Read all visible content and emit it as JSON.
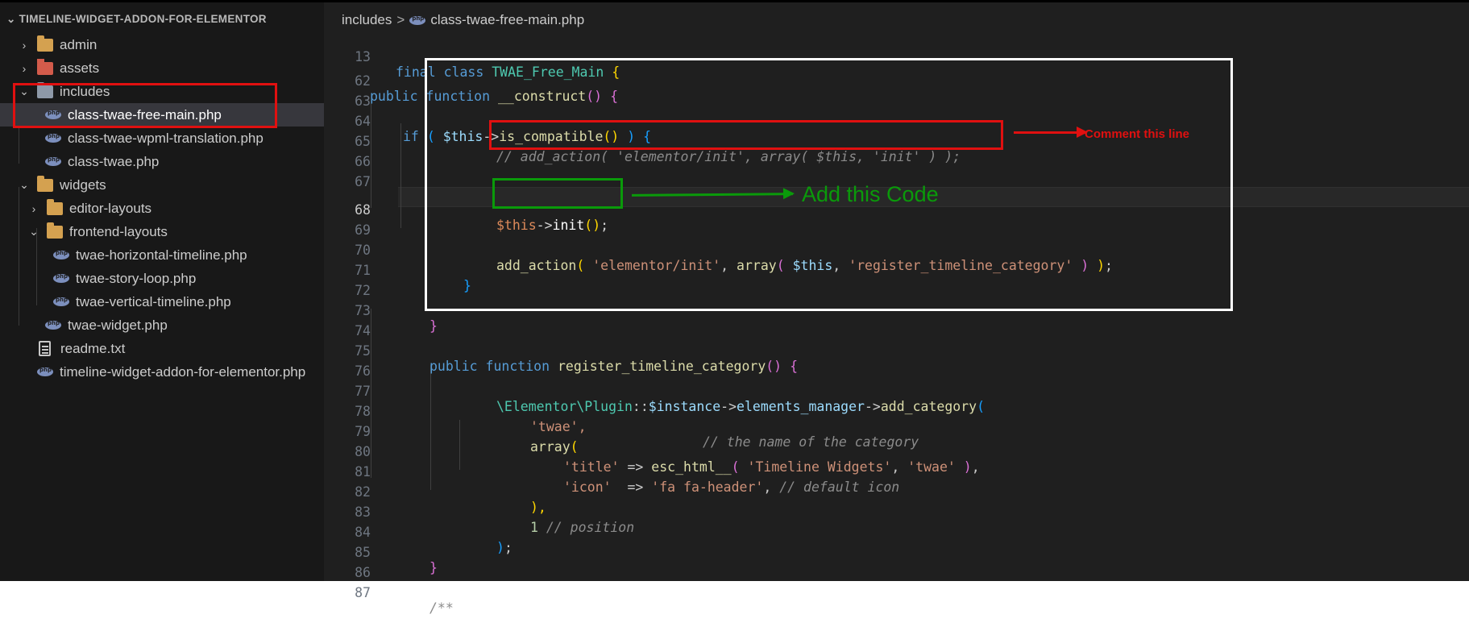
{
  "explorer": {
    "header": "TIMELINE-WIDGET-ADDON-FOR-ELEMENTOR",
    "items": [
      {
        "label": "admin",
        "type": "folder",
        "expanded": false,
        "depth": 0
      },
      {
        "label": "assets",
        "type": "folder-assets",
        "expanded": false,
        "depth": 0
      },
      {
        "label": "includes",
        "type": "folder-gray",
        "expanded": true,
        "depth": 0
      },
      {
        "label": "class-twae-free-main.php",
        "type": "php",
        "depth": 1,
        "selected": true
      },
      {
        "label": "class-twae-wpml-translation.php",
        "type": "php",
        "depth": 1
      },
      {
        "label": "class-twae.php",
        "type": "php",
        "depth": 1
      },
      {
        "label": "widgets",
        "type": "folder",
        "expanded": true,
        "depth": 0
      },
      {
        "label": "editor-layouts",
        "type": "folder",
        "expanded": false,
        "depth": 1
      },
      {
        "label": "frontend-layouts",
        "type": "folder",
        "expanded": true,
        "depth": 1
      },
      {
        "label": "twae-horizontal-timeline.php",
        "type": "php",
        "depth": 2
      },
      {
        "label": "twae-story-loop.php",
        "type": "php",
        "depth": 2
      },
      {
        "label": "twae-vertical-timeline.php",
        "type": "php",
        "depth": 2
      },
      {
        "label": "twae-widget.php",
        "type": "php",
        "depth": 1
      },
      {
        "label": "readme.txt",
        "type": "txt",
        "depth": 0
      },
      {
        "label": "timeline-widget-addon-for-elementor.php",
        "type": "php",
        "depth": 0
      }
    ]
  },
  "breadcrumb": {
    "folder": "includes",
    "separator": ">",
    "file": "class-twae-free-main.php"
  },
  "editor": {
    "active_line": "68",
    "sticky": {
      "num": "13",
      "text": "final class TWAE_Free_Main {"
    },
    "lines": [
      {
        "num": "62"
      },
      {
        "num": "63"
      },
      {
        "num": "64"
      },
      {
        "num": "65"
      },
      {
        "num": "66"
      },
      {
        "num": "67"
      },
      {
        "num": "68"
      },
      {
        "num": "69"
      },
      {
        "num": "70"
      },
      {
        "num": "71"
      },
      {
        "num": "72"
      },
      {
        "num": "73"
      },
      {
        "num": "74"
      },
      {
        "num": "75"
      },
      {
        "num": "76"
      },
      {
        "num": "77"
      },
      {
        "num": "78"
      },
      {
        "num": "79"
      },
      {
        "num": "80"
      },
      {
        "num": "81"
      },
      {
        "num": "82"
      },
      {
        "num": "83"
      },
      {
        "num": "84"
      },
      {
        "num": "85"
      },
      {
        "num": "86"
      },
      {
        "num": "87"
      }
    ],
    "code": {
      "l62_kw1": "public",
      "l62_kw2": "function",
      "l62_fn": "__construct",
      "l64_if": "if",
      "l64_this": "$this",
      "l64_fn": "is_compatible",
      "l65_comment": "// add_action( 'elementor/init', array( $this, 'init' ) );",
      "l68_this": "$this",
      "l68_fn": "init",
      "l70_fn": "add_action",
      "l70_s1": "'elementor/init'",
      "l70_arr": "array",
      "l70_this": "$this",
      "l70_s2": "'register_timeline_category'",
      "l75_kw1": "public",
      "l75_kw2": "function",
      "l75_fn": "register_timeline_category",
      "l77_ns1": "\\Elementor",
      "l77_ns2": "\\Plugin",
      "l77_inst": "$instance",
      "l77_mgr": "elements_manager",
      "l77_fn": "add_category",
      "l78_str": "'twae',",
      "l78_cmt": "// the name of the category",
      "l79_arr": "array",
      "l80_key": "'title'",
      "l80_fn": "esc_html__",
      "l80_s1": "'Timeline Widgets'",
      "l80_s2": "'twae'",
      "l81_key": "'icon'",
      "l81_val": "'fa fa-header'",
      "l81_cmt": "// default icon",
      "l83_num": "1",
      "l83_cmt": "// position",
      "l87_cmt": "/**"
    }
  },
  "annotations": {
    "comment_label": "Comment this line",
    "add_label": "Add this Code",
    "colors": {
      "red": "#e01010",
      "green": "#0a9a0a",
      "white": "#ffffff"
    }
  }
}
